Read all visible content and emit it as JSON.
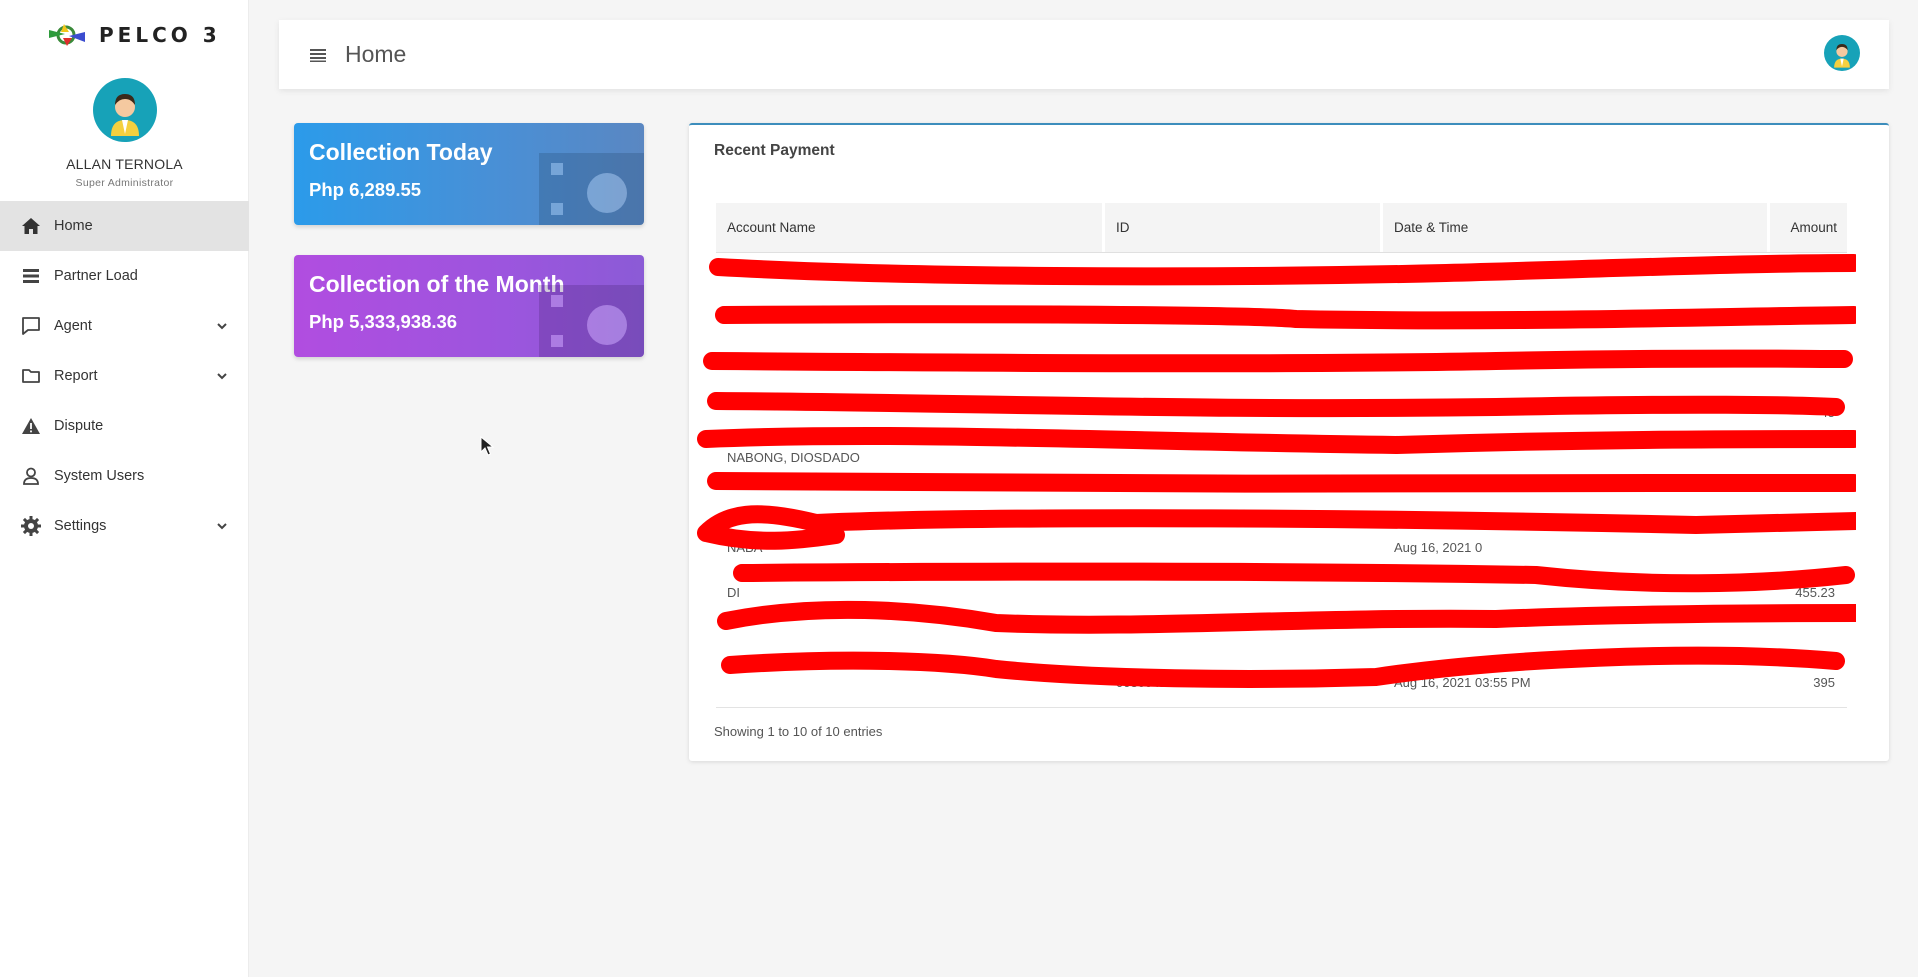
{
  "brand": {
    "name": "PELCO 3",
    "logo_icon": "pelco-logo-icon"
  },
  "profile": {
    "name": "ALLAN TERNOLA",
    "role": "Super Administrator",
    "avatar_icon": "user-avatar-icon"
  },
  "nav": {
    "items": [
      {
        "label": "Home",
        "icon": "home-icon",
        "active": true,
        "has_submenu": false
      },
      {
        "label": "Partner Load",
        "icon": "list-icon",
        "active": false,
        "has_submenu": false
      },
      {
        "label": "Agent",
        "icon": "chat-icon",
        "active": false,
        "has_submenu": true
      },
      {
        "label": "Report",
        "icon": "folder-icon",
        "active": false,
        "has_submenu": true
      },
      {
        "label": "Dispute",
        "icon": "warning-icon",
        "active": false,
        "has_submenu": false
      },
      {
        "label": "System Users",
        "icon": "user-icon",
        "active": false,
        "has_submenu": false
      },
      {
        "label": "Settings",
        "icon": "gear-icon",
        "active": false,
        "has_submenu": true
      }
    ]
  },
  "header": {
    "title": "Home",
    "menu_icon": "hamburger-icon"
  },
  "cards": {
    "today": {
      "title": "Collection Today",
      "value": "Php 6,289.55",
      "color": "#2b9bea"
    },
    "month": {
      "title": "Collection of the Month",
      "value": "Php 5,333,938.36",
      "color": "#b14de0"
    }
  },
  "recent_payment": {
    "title": "Recent Payment",
    "columns": [
      "Account Name",
      "ID",
      "Date & Time",
      "Amount"
    ],
    "rows": [
      {
        "name": "",
        "id": "",
        "datetime": "",
        "amount": ""
      },
      {
        "name": "",
        "id": "",
        "datetime": "",
        "amount": ""
      },
      {
        "name": "",
        "id": "",
        "datetime": "",
        "amount": ""
      },
      {
        "name": "",
        "id": "",
        "datetime": "",
        "amount": "45"
      },
      {
        "name": "NABONG, DIOSDADO",
        "id": "",
        "datetime": "",
        "amount": ""
      },
      {
        "name": "",
        "id": "",
        "datetime": "",
        "amount": ""
      },
      {
        "name": "NABA",
        "id": "",
        "datetime": "Aug 16, 2021 0",
        "amount": ""
      },
      {
        "name": "DI",
        "id": "",
        "datetime": "",
        "amount": "455.23"
      },
      {
        "name": "",
        "id": "",
        "datetime": "",
        "amount": ""
      },
      {
        "name": "",
        "id": "00300413",
        "datetime": "Aug 16, 2021 03:55 PM",
        "amount": "395"
      }
    ],
    "info": "Showing 1 to 10 of 10 entries",
    "accent_color": "#3c8dbc",
    "redaction_color": "#ff0000"
  }
}
